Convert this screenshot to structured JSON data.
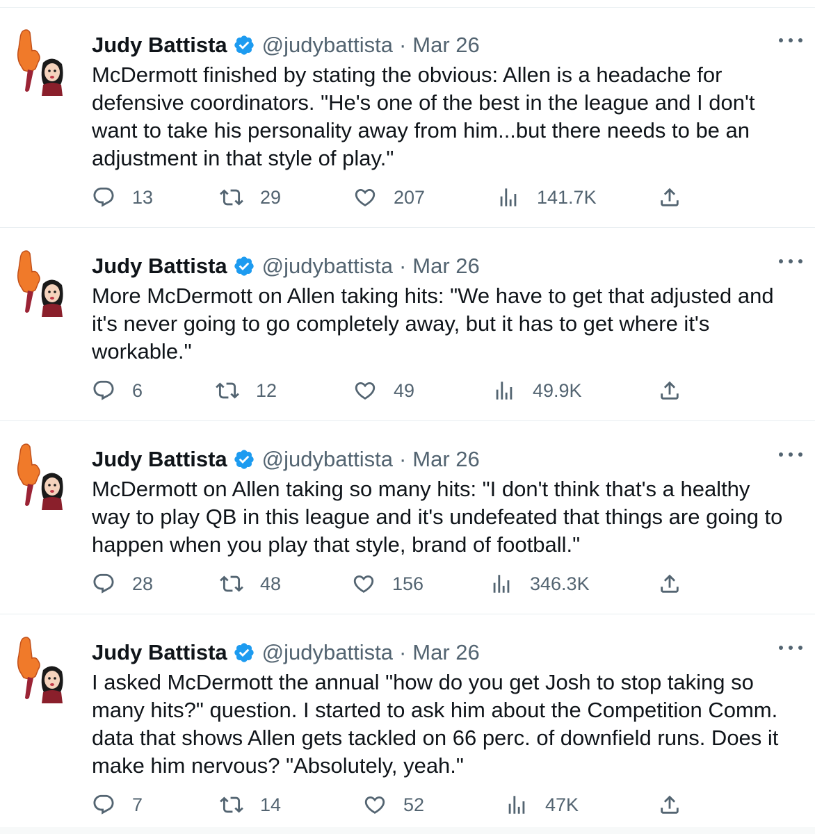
{
  "colors": {
    "text": "#0f1419",
    "secondary": "#536471",
    "verified": "#1d9bf0",
    "border": "#e6ecf0"
  },
  "icons": {
    "reply": "speech-bubble-icon",
    "retweet": "retweet-arrows-icon",
    "like": "heart-icon",
    "views": "bar-chart-icon",
    "share": "upload-arrow-icon",
    "more": "ellipsis-icon",
    "verified": "verified-badge-icon"
  },
  "tweets": [
    {
      "name": "Judy Battista",
      "handle": "@judybattista",
      "separator": "·",
      "date": "Mar 26",
      "text": "McDermott finished by stating the obvious: Allen is a headache for defensive coordinators. \"He's one of the best in the league and I don't want to take his personality away from him...but there needs to be an adjustment in that style of play.\"",
      "replies": "13",
      "retweets": "29",
      "likes": "207",
      "views": "141.7K"
    },
    {
      "name": "Judy Battista",
      "handle": "@judybattista",
      "separator": "·",
      "date": "Mar 26",
      "text": "More McDermott on Allen taking hits: \"We have to get that adjusted and it's never going to go completely away, but it has to get where it's workable.\"",
      "replies": "6",
      "retweets": "12",
      "likes": "49",
      "views": "49.9K"
    },
    {
      "name": "Judy Battista",
      "handle": "@judybattista",
      "separator": "·",
      "date": "Mar 26",
      "text": "McDermott on Allen taking so many hits: \"I don't think that's a healthy way to play QB in this league and it's undefeated that things are going to happen when you play that style, brand of football.\"",
      "replies": "28",
      "retweets": "48",
      "likes": "156",
      "views": "346.3K"
    },
    {
      "name": "Judy Battista",
      "handle": "@judybattista",
      "separator": "·",
      "date": "Mar 26",
      "text": "I asked McDermott the annual \"how do you get Josh to stop taking so many hits?\" question. I started to ask him about the Competition Comm. data that shows Allen gets tackled on 66 perc. of downfield runs. Does it make him nervous? \"Absolutely, yeah.\"",
      "replies": "7",
      "retweets": "14",
      "likes": "52",
      "views": "47K"
    }
  ]
}
